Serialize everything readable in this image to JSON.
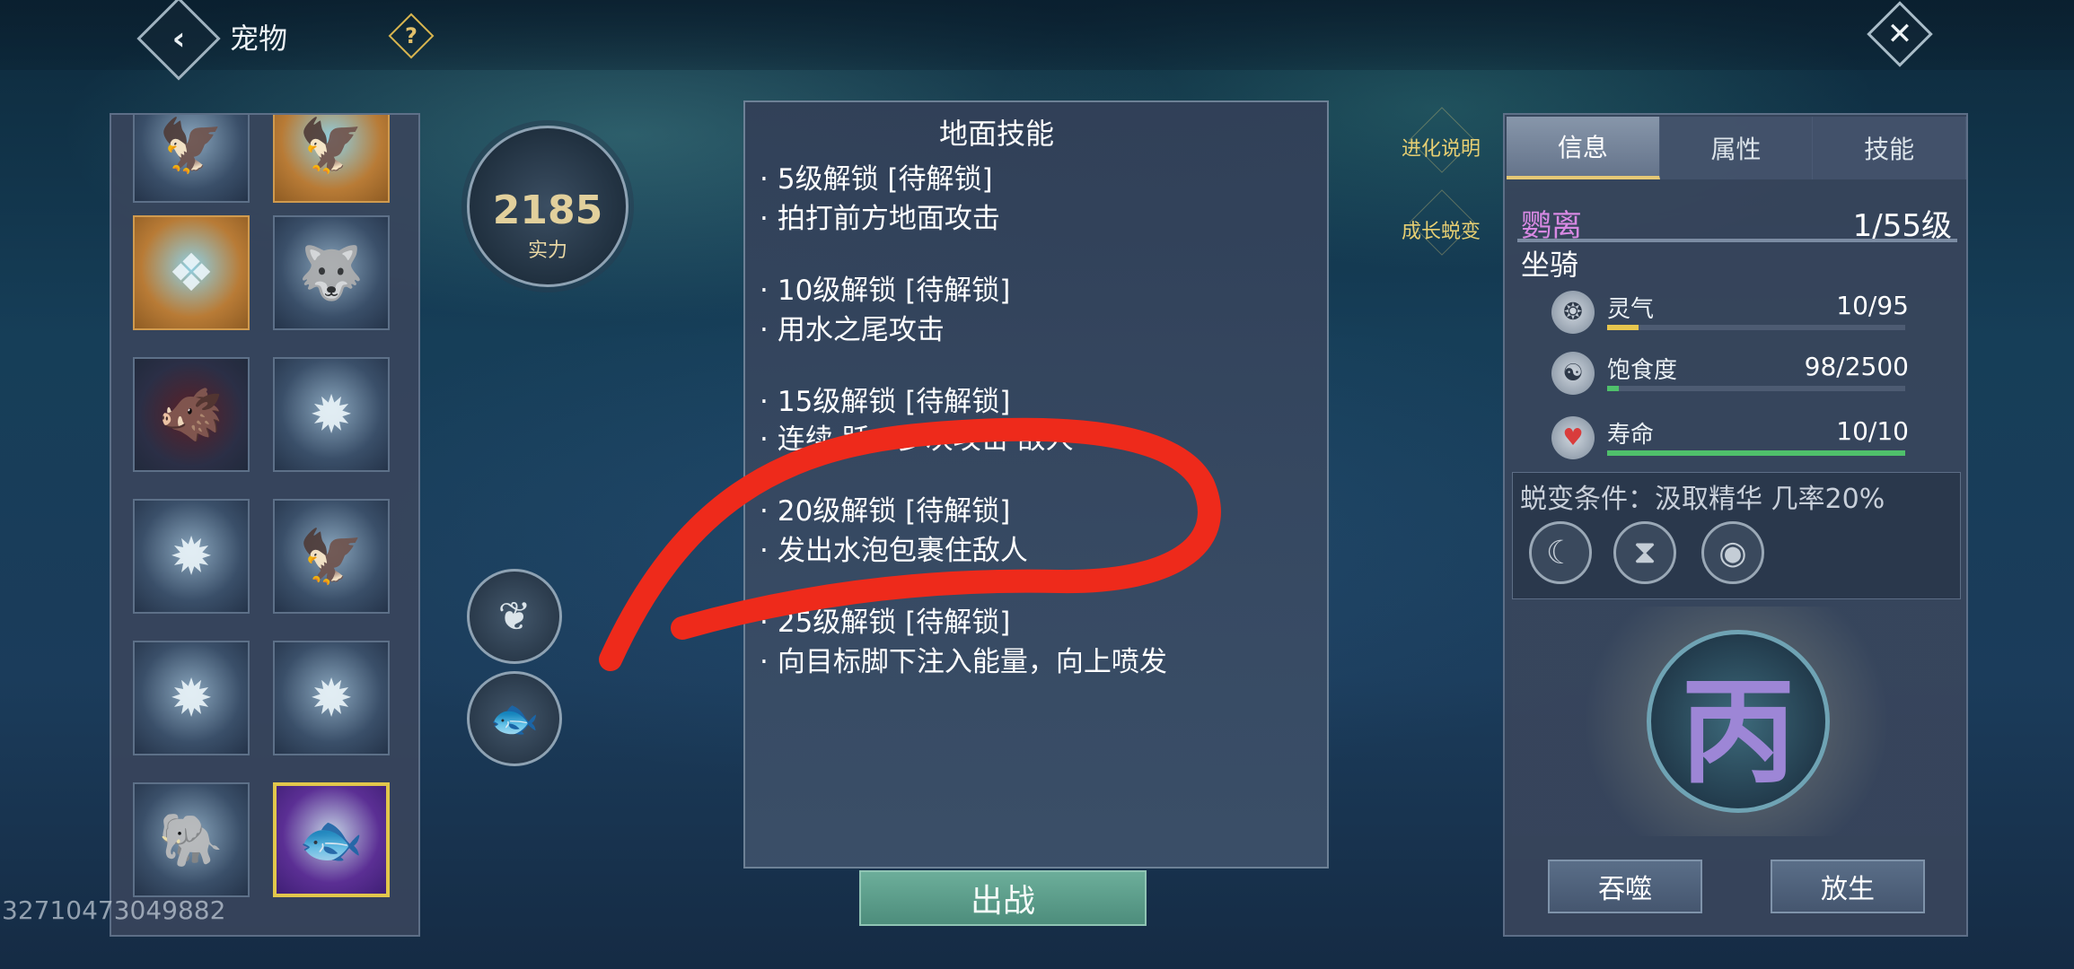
{
  "header": {
    "title": "宠物",
    "help_symbol": "?",
    "back_symbol": "‹",
    "close_symbol": "✕"
  },
  "pets": [
    {
      "glyph": "🦅",
      "style": "dark"
    },
    {
      "glyph": "🦅",
      "style": "orange"
    },
    {
      "glyph": "❖",
      "style": "orange"
    },
    {
      "glyph": "🐺",
      "style": ""
    },
    {
      "glyph": "🐗",
      "style": "dark"
    },
    {
      "glyph": "✹",
      "style": ""
    },
    {
      "glyph": "✹",
      "style": ""
    },
    {
      "glyph": "🦅",
      "style": ""
    },
    {
      "glyph": "✹",
      "style": ""
    },
    {
      "glyph": "✹",
      "style": ""
    },
    {
      "glyph": "🐘",
      "style": ""
    },
    {
      "glyph": "🐟",
      "style": "purple"
    }
  ],
  "power": {
    "value": "2185",
    "label": "实力"
  },
  "round_buttons": [
    {
      "glyph": "❦"
    },
    {
      "glyph": "🐟"
    }
  ],
  "skill_panel": {
    "title": "地面技能",
    "lines": [
      "5级解锁   [待解锁]",
      "拍打前方地面攻击",
      "10级解锁   [待解锁]",
      "用水之尾攻击",
      "15级解锁   [待解锁]",
      "连续  跃，多次攻击  敌人",
      "20级解锁   [待解锁]",
      "发出水泡包裹住敌人",
      "25级解锁   [待解锁]",
      "向目标脚下注入能量，向上喷发"
    ],
    "bullet": "·"
  },
  "fight_button": "出战",
  "uid": "32710473049882",
  "side_links": {
    "evolution_info": "进化说明",
    "growth": "成长蜕变"
  },
  "info": {
    "tabs": [
      "信息",
      "属性",
      "技能"
    ],
    "active_tab": 0,
    "name": "鹦离",
    "level": "1/55级",
    "type": "坐骑",
    "stats": [
      {
        "label": "灵气",
        "value": "10/95",
        "icon": "spirit-icon",
        "fill": 0.105
      },
      {
        "label": "饱食度",
        "value": "98/2500",
        "icon": "hunger-icon",
        "fill": 0.039
      },
      {
        "label": "寿命",
        "value": "10/10",
        "icon": "heart-icon",
        "fill": 1.0
      }
    ],
    "evolution": "蜕变条件：汲取精华 几率20%",
    "evolution_icons": [
      "moon-icon",
      "hourglass-icon",
      "eye-icon"
    ],
    "grade_glyph": "丙",
    "devour_button": "吞噬",
    "release_button": "放生"
  },
  "colors": {
    "accent_gold": "#e6c875",
    "name_pink": "#d889e3",
    "fight_green": "#5c9e8a",
    "scribble_red": "#ee2a1b"
  }
}
